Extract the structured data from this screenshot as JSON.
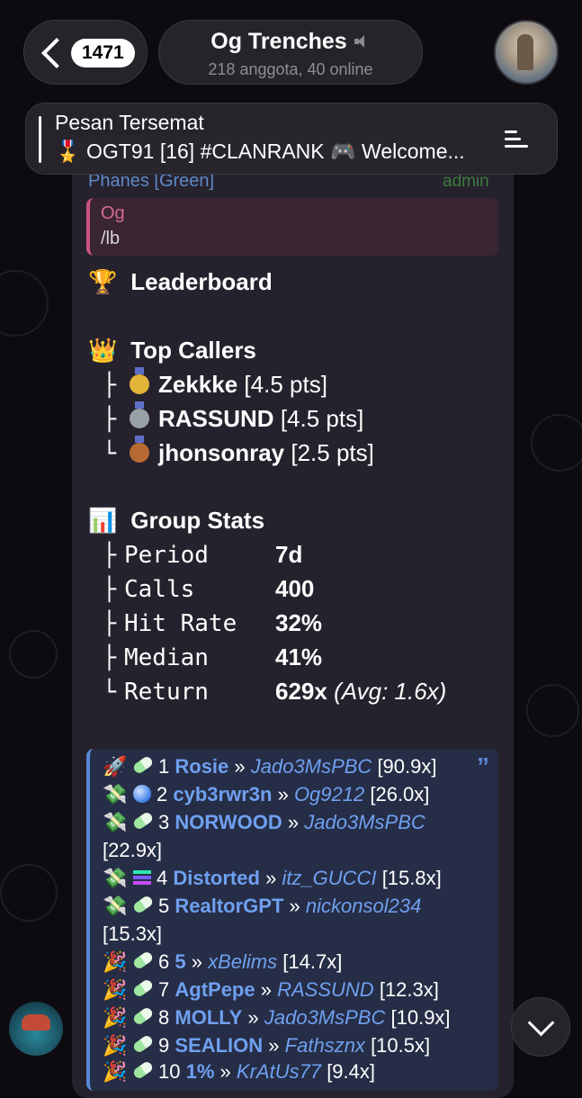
{
  "header": {
    "unread_count": "1471",
    "chat_title": "Og Trenches",
    "chat_subtitle": "218 anggota, 40 online"
  },
  "pinned": {
    "title": "Pesan Tersemat",
    "text": "🎖️ OGT91 [16] #CLANRANK 🎮 Welcome..."
  },
  "message": {
    "sender": "Phanes [Green]",
    "admin_label": "admin",
    "reply_to_name": "Og",
    "reply_to_text": "/lb",
    "leaderboard_title": "Leaderboard",
    "top_callers_title": "Top Callers",
    "top_callers": [
      {
        "tree": "├",
        "name": "Zekkke",
        "pts": "[4.5 pts]"
      },
      {
        "tree": "├",
        "name": "RASSUND",
        "pts": "[4.5 pts]"
      },
      {
        "tree": "└",
        "name": "jhonsonray",
        "pts": "[2.5 pts]"
      }
    ],
    "group_stats_title": "Group Stats",
    "stats": [
      {
        "tree": "├",
        "label": "Period",
        "value": "7d"
      },
      {
        "tree": "├",
        "label": "Calls",
        "value": "400"
      },
      {
        "tree": "├",
        "label": "Hit Rate",
        "value": "32%"
      },
      {
        "tree": "├",
        "label": "Median",
        "value": "41%"
      },
      {
        "tree": "└",
        "label": "Return",
        "value": "629x",
        "extra": "(Avg: 1.6x)"
      }
    ],
    "top_calls": [
      {
        "lead": "🚀",
        "rank": "1",
        "name": "Rosie",
        "sep": "»",
        "user": "Jado3MsPBC",
        "mult": "[90.9x]"
      },
      {
        "lead": "💸",
        "rank": "2",
        "name": "cyb3rwr3n",
        "sep": "»",
        "user": "Og9212",
        "mult": "[26.0x]"
      },
      {
        "lead": "💸",
        "rank": "3",
        "name": "NORWOOD",
        "sep": "»",
        "user": "Jado3MsPBC",
        "mult": "[22.9x]"
      },
      {
        "lead": "💸",
        "rank": "4",
        "name": "Distorted",
        "sep": "»",
        "user": "itz_GUCCI",
        "mult": "[15.8x]"
      },
      {
        "lead": "💸",
        "rank": "5",
        "name": "RealtorGPT",
        "sep": "»",
        "user": "nickonsol234",
        "mult": "[15.3x]"
      },
      {
        "lead": "🎉",
        "rank": "6",
        "name": "5",
        "sep": "»",
        "user": "xBelims",
        "mult": "[14.7x]"
      },
      {
        "lead": "🎉",
        "rank": "7",
        "name": "AgtPepe",
        "sep": "»",
        "user": "RASSUND",
        "mult": "[12.3x]"
      },
      {
        "lead": "🎉",
        "rank": "8",
        "name": "MOLLY",
        "sep": "»",
        "user": "Jado3MsPBC",
        "mult": "[10.9x]"
      },
      {
        "lead": "🎉",
        "rank": "9",
        "name": "SEALION",
        "sep": "»",
        "user": "Fathsznx",
        "mult": "[10.5x]"
      },
      {
        "lead": "🎉",
        "rank": "10",
        "name": "1%",
        "sep": "»",
        "user": "KrAtUs77",
        "mult": "[9.4x]"
      }
    ]
  },
  "icons": {
    "back": "chevron-left-icon",
    "mute": "mute-icon",
    "pin_list": "pin-list-icon",
    "scroll_down": "chevron-down-icon",
    "trophy": "🏆",
    "crown": "👑",
    "chart": "📊",
    "quote": "quote-icon"
  },
  "colors": {
    "background": "#0d0b10",
    "bubble": "#26222d",
    "link_blue": "#6fa0f0",
    "reply_accent": "#c9547f",
    "admin_green": "#3e7a3e"
  }
}
